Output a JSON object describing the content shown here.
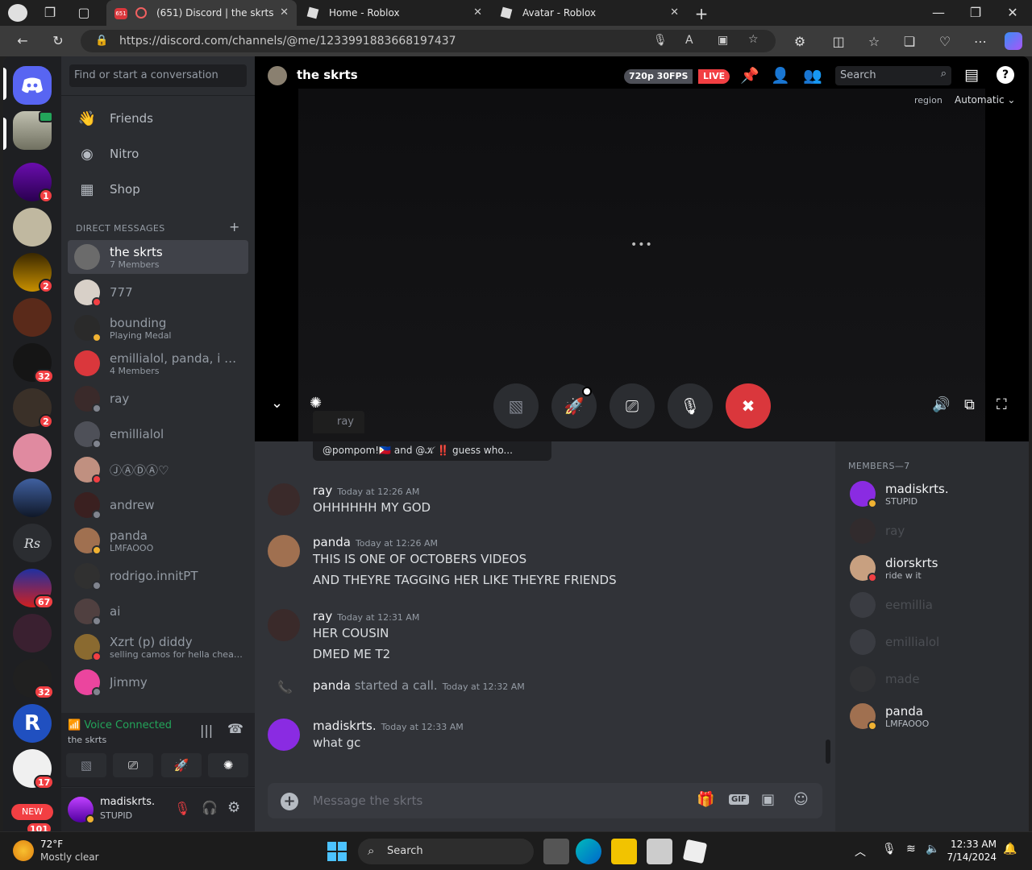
{
  "browser": {
    "tabs": [
      {
        "label": "(651) Discord | the skrts",
        "badge": "651"
      },
      {
        "label": "Home - Roblox"
      },
      {
        "label": "Avatar - Roblox"
      }
    ],
    "url": "https://discord.com/channels/@me/1233991883668197437"
  },
  "discord": {
    "find_placeholder": "Find or start a conversation",
    "nav": [
      {
        "label": "Friends"
      },
      {
        "label": "Nitro"
      },
      {
        "label": "Shop"
      }
    ],
    "dm_header": "DIRECT MESSAGES",
    "dm_add": "+",
    "dms": [
      {
        "name": "the skrts",
        "sub": "7 Members",
        "color": "#6b6b6b"
      },
      {
        "name": "777",
        "sub": "",
        "color": "#d8d0c8"
      },
      {
        "name": "bounding",
        "sub": "Playing Medal",
        "color": "#2a2a2a"
      },
      {
        "name": "emillialol, panda, i lik...",
        "sub": "4 Members",
        "color": "#da373c"
      },
      {
        "name": "ray",
        "sub": "",
        "color": "#3a2a2a"
      },
      {
        "name": "emillialol",
        "sub": "",
        "color": "#4e5058"
      },
      {
        "name": "ⒿⒶⒹⒶ♡",
        "sub": "",
        "color": "#c09080"
      },
      {
        "name": "andrew",
        "sub": "",
        "color": "#3a2020"
      },
      {
        "name": "panda",
        "sub": "LMFAOOO",
        "color": "#a07050"
      },
      {
        "name": "rodrigo.innitPT",
        "sub": "",
        "color": "#303030"
      },
      {
        "name": "ai",
        "sub": "",
        "color": "#504040"
      },
      {
        "name": "Xzrt (p) diddy",
        "sub": "selling camos for hella cheap!!!",
        "color": "#8a6a30"
      },
      {
        "name": "Jimmy",
        "sub": "",
        "color": "#eb459e"
      }
    ],
    "guild_badges": [
      "1",
      "2",
      "32",
      "2",
      "67",
      "32",
      "17",
      "101"
    ],
    "guild_labels": {
      "rs": "Rs",
      "new": "NEW"
    },
    "voice": {
      "status": "Voice Connected",
      "channel": "the skrts"
    },
    "user": {
      "name": "madiskrts.",
      "status": "STUPID"
    },
    "stream": {
      "title": "the skrts",
      "quality": "720p 30FPS",
      "live": "LIVE",
      "search": "Search",
      "region_label": "region",
      "region_value": "Automatic",
      "streamer": "ray",
      "preview": "@pompom!🇵🇭 and @𝒦 ‼️ guess who..."
    },
    "messages": [
      {
        "author": "ray",
        "time": "Today at 12:26 AM",
        "lines": [
          "OHHHHHH MY GOD"
        ],
        "color": "#3a2a2a"
      },
      {
        "author": "panda",
        "time": "Today at 12:26 AM",
        "lines": [
          "THIS IS ONE OF OCTOBERS VIDEOS",
          "AND THEYRE TAGGING HER LIKE THEYRE FRIENDS"
        ],
        "color": "#a07050"
      },
      {
        "author": "ray",
        "time": "Today at 12:31 AM",
        "lines": [
          "HER COUSIN",
          "DMED ME T2"
        ],
        "color": "#3a2a2a"
      },
      {
        "author": "panda",
        "action": "started a call.",
        "time": "Today at 12:32 AM"
      },
      {
        "author": "madiskrts.",
        "time": "Today at 12:33 AM",
        "lines": [
          "what gc"
        ],
        "color": "#8a2be2"
      }
    ],
    "composer_placeholder": "Message the skrts",
    "members_header": "MEMBERS—7",
    "members": [
      {
        "name": "madiskrts.",
        "sub": "STUPID",
        "online": true,
        "color": "#8a2be2"
      },
      {
        "name": "ray",
        "sub": "",
        "online": false,
        "color": "#3a2a2a"
      },
      {
        "name": "diorskrts",
        "sub": "ride w it",
        "online": true,
        "color": "#c8a080"
      },
      {
        "name": "eemillia",
        "sub": "",
        "online": false,
        "color": "#4e5058"
      },
      {
        "name": "emillialol",
        "sub": "",
        "online": false,
        "color": "#4e5058"
      },
      {
        "name": "made",
        "sub": "",
        "online": false,
        "color": "#3a3a3a"
      },
      {
        "name": "panda",
        "sub": "LMFAOOO",
        "online": true,
        "color": "#a07050"
      }
    ]
  },
  "taskbar": {
    "weather_temp": "72°F",
    "weather_desc": "Mostly clear",
    "search": "Search",
    "time": "12:33 AM",
    "date": "7/14/2024"
  }
}
